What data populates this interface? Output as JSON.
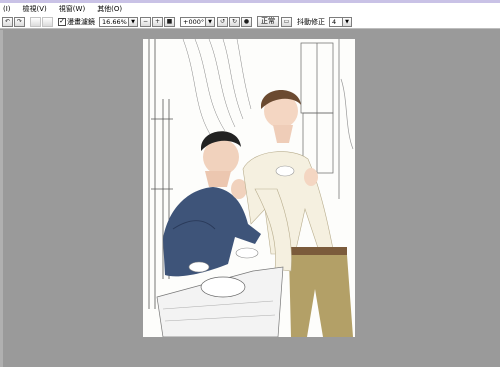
{
  "menu": {
    "items": [
      {
        "label": "(I)"
      },
      {
        "label": "檢視(V)"
      },
      {
        "label": "視窗(W)"
      },
      {
        "label": "其他(O)"
      }
    ]
  },
  "toolbar": {
    "smooth_scaling_checked": true,
    "smooth_scaling_label": "漫畫濾鏡",
    "zoom_value": "16.66%",
    "rotation_value": "+000°",
    "normal_label": "正常",
    "stabilizer_label": "抖動修正",
    "stabilizer_value": "4"
  },
  "colors": {
    "workspace": "#9a9a9a",
    "title_strip": "#c9c2e6",
    "toolbar_bg": "#ffffff"
  },
  "icons": {
    "undo": "undo-icon",
    "redo": "redo-icon",
    "zoom_out": "minus-icon",
    "zoom_in": "plus-icon",
    "fit": "fit-icon",
    "rotate_left": "rotate-left-icon",
    "rotate_right": "rotate-right-icon",
    "rotate_reset": "rotate-reset-icon"
  }
}
